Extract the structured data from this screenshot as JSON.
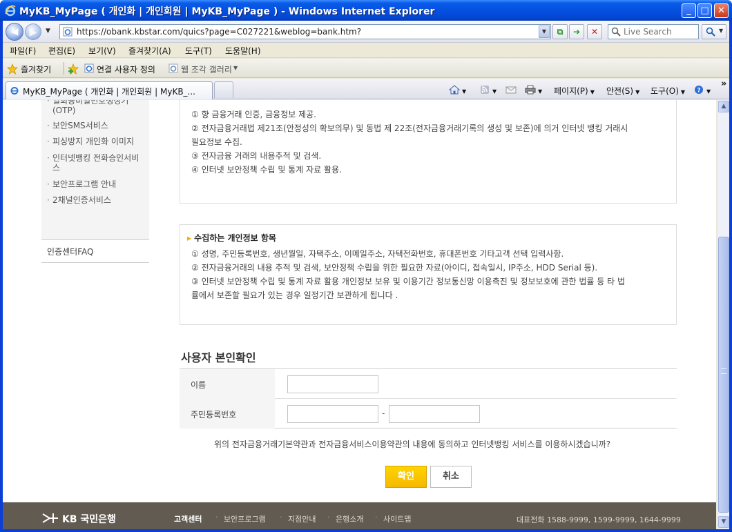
{
  "window": {
    "title": "MyKB_MyPage ( 개인화 | 개인회원 | MyKB_MyPage ) - Windows Internet Explorer",
    "minimize_label": "_",
    "maximize_label": "□",
    "close_label": "✕"
  },
  "addressbar": {
    "url": "https://obank.kbstar.com/quics?page=C027221&weblog=bank.htm?",
    "search_placeholder": "Live Search"
  },
  "menubar": {
    "items": [
      "파일(F)",
      "편집(E)",
      "보기(V)",
      "즐겨찾기(A)",
      "도구(T)",
      "도움말(H)"
    ]
  },
  "favorites": {
    "label": "즐겨찾기",
    "links": [
      "연결 사용자 정의",
      "웹 조각 갤러리"
    ]
  },
  "tabs": {
    "active_title": "MyKB_MyPage ( 개인화 | 개인회원 | MyKB_...",
    "tools": [
      "페이지(P)",
      "안전(S)",
      "도구(O)"
    ],
    "overflow": "»"
  },
  "leftnav": {
    "items": [
      "일회용비밀번호생성기(OTP)",
      "보안SMS서비스",
      "피싱방지 개인화 이미지",
      "인터넷뱅킹 전화승인서비스",
      "보안프로그램 안내",
      "2채널인증서비스"
    ],
    "faq": "인증센터FAQ"
  },
  "purpose_box": {
    "lines": [
      "① 향 금융거래 인증, 금융정보 제공.",
      "② 전자금융거래법 제21조(안정성의 확보의무) 및 동법 제 22조(전자금융거래기록의 생성 및 보존)에 의거 인터넷 뱅킹 거래시",
      "필요정보 수집.",
      "③ 전자금융 거래의 내용추적 및 검색.",
      "④ 인터넷 보안정책 수립 및 통계 자료 활용."
    ]
  },
  "collect_box": {
    "heading": "수집하는 개인정보 항목",
    "lines": [
      "① 성명, 주민등록번호, 생년월일, 자택주소, 이메일주소, 자택전화번호, 휴대폰번호 기타고객 선택 입력사항.",
      "② 전자금융거래의 내용 추적 및 검색, 보안정책 수립을 위한 필요한 자료(아이디, 접속일시, IP주소, HDD Serial 등).",
      "③ 인터넷 보안정책 수립 및 통계 자료 활용 개인정보 보유 및 이용기간 정보통신망 이용촉진 및 정보보호에 관한 법률 등 타 법",
      "률에서 보존할 필요가 있는 경우 일정기간 보관하게 됩니다 ."
    ]
  },
  "verify": {
    "title": "사용자 본인확인",
    "name_label": "이름",
    "ssn_label": "주민등록번호",
    "name_value": "",
    "ssn_front_value": "",
    "ssn_back_value": "",
    "dash": "-",
    "agree_text": "위의 전자금융거래기본약관과 전자금융서비스이용약관의 내용에 동의하고 인터넷뱅킹 서비스를 이용하시겠습니까?",
    "confirm_label": "확인",
    "cancel_label": "취소"
  },
  "footer": {
    "logo_text": "KB 국민은행",
    "links": [
      "고객센터",
      "보안프로그램",
      "지점안내",
      "은행소개",
      "사이트맵"
    ],
    "separator": "·",
    "phone": "대표전화 1588-9999, 1599-9999, 1644-9999"
  },
  "colors": {
    "titlebar": "#0550e0",
    "confirm_button": "#ffc800",
    "footer_bg": "#625b52",
    "heading_arrow": "#f0b000"
  }
}
